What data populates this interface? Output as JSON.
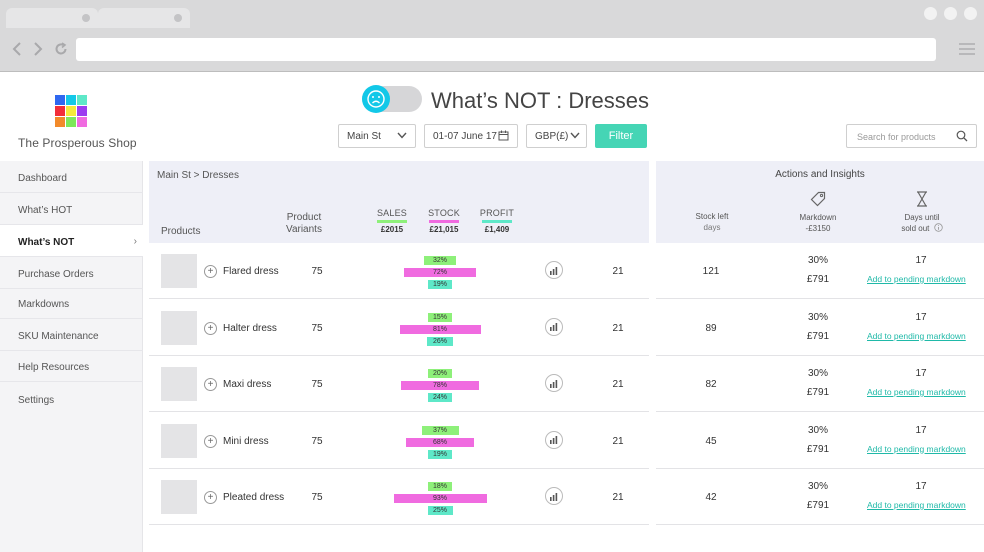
{
  "colors": {
    "accent": "#45d5b5",
    "sales": "#8ef07a",
    "stock": "#f06be0",
    "profit": "#5ee8c8",
    "toggle": "#12c8e8",
    "link": "#1fb9a8"
  },
  "icons": {
    "back": "chevron-left",
    "forward": "chevron-right",
    "reload": "reload",
    "menu": "hamburger",
    "mood": "sad-face",
    "calendar": "calendar",
    "search": "magnifier",
    "tag": "price-tag",
    "hourglass": "hourglass",
    "info": "info-circle",
    "chart": "bar-chart"
  },
  "header": {
    "brand": "The Prosperous Shop",
    "title": "What’s NOT : Dresses",
    "store": "Main St",
    "dates": "01-07 June 17",
    "currency": "GBP(£)",
    "filter_label": "Filter",
    "search_placeholder": "Search for products"
  },
  "sidebar": {
    "items": [
      {
        "label": "Dashboard"
      },
      {
        "label": "What’s HOT"
      },
      {
        "label": "What’s NOT"
      },
      {
        "label": "Purchase Orders"
      },
      {
        "label": "Markdowns"
      },
      {
        "label": "SKU Maintenance"
      },
      {
        "label": "Help Resources"
      },
      {
        "label": "Settings"
      }
    ]
  },
  "main": {
    "breadcrumb": "Main St > Dresses",
    "col_products": "Products",
    "col_variants_1": "Product",
    "col_variants_2": "Variants",
    "sales": {
      "label": "SALES",
      "total": "£2015"
    },
    "stock": {
      "label": "STOCK",
      "total": "£21,015"
    },
    "profit": {
      "label": "PROFIT",
      "total": "£1,409"
    },
    "rows": [
      {
        "name": "Flared dress",
        "variants": "75",
        "sales": "32%",
        "stock": "72%",
        "profit": "19%",
        "sales_frac": 0.32,
        "stock_frac": 0.72,
        "profit_frac": 0.19,
        "count": "21"
      },
      {
        "name": "Halter dress",
        "variants": "75",
        "sales": "15%",
        "stock": "81%",
        "profit": "26%",
        "sales_frac": 0.15,
        "stock_frac": 0.81,
        "profit_frac": 0.26,
        "count": "21"
      },
      {
        "name": "Maxi dress",
        "variants": "75",
        "sales": "20%",
        "stock": "78%",
        "profit": "24%",
        "sales_frac": 0.2,
        "stock_frac": 0.78,
        "profit_frac": 0.24,
        "count": "21"
      },
      {
        "name": "Mini dress",
        "variants": "75",
        "sales": "37%",
        "stock": "68%",
        "profit": "19%",
        "sales_frac": 0.37,
        "stock_frac": 0.68,
        "profit_frac": 0.19,
        "count": "21"
      },
      {
        "name": "Pleated dress",
        "variants": "75",
        "sales": "18%",
        "stock": "93%",
        "profit": "25%",
        "sales_frac": 0.18,
        "stock_frac": 0.93,
        "profit_frac": 0.25,
        "count": "21"
      }
    ]
  },
  "insights": {
    "title": "Actions and Insights",
    "stock_left_1": "Stock left",
    "stock_left_2": "days",
    "markdown_1": "Markdown",
    "markdown_2": "-£3150",
    "days_until_1": "Days until",
    "days_until_2": "sold out",
    "add_label": "Add to pending markdown",
    "rows": [
      {
        "stock_left": "121",
        "markdown_pct": "30%",
        "markdown_amt": "£791",
        "days": "17"
      },
      {
        "stock_left": "89",
        "markdown_pct": "30%",
        "markdown_amt": "£791",
        "days": "17"
      },
      {
        "stock_left": "82",
        "markdown_pct": "30%",
        "markdown_amt": "£791",
        "days": "17"
      },
      {
        "stock_left": "45",
        "markdown_pct": "30%",
        "markdown_amt": "£791",
        "days": "17"
      },
      {
        "stock_left": "42",
        "markdown_pct": "30%",
        "markdown_amt": "£791",
        "days": "17"
      }
    ]
  }
}
